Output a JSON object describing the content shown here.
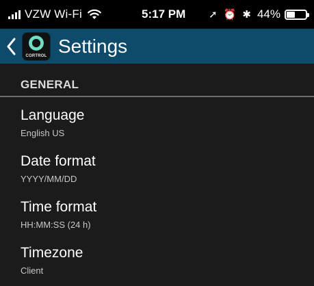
{
  "status_bar": {
    "carrier": "VZW Wi-Fi",
    "time": "5:17 PM",
    "location_glyph": "➚",
    "alarm_glyph": "⏰",
    "bluetooth_glyph": "✱",
    "battery_percent": "44%",
    "battery_level": 0.44
  },
  "nav": {
    "title": "Settings",
    "logo_text": "CORTROL"
  },
  "section": {
    "header": "GENERAL"
  },
  "settings": [
    {
      "title": "Language",
      "value": "English US"
    },
    {
      "title": "Date format",
      "value": "YYYY/MM/DD"
    },
    {
      "title": "Time format",
      "value": "HH:MM:SS (24 h)"
    },
    {
      "title": "Timezone",
      "value": "Client"
    }
  ],
  "colors": {
    "status_bar_bg": "#000000",
    "nav_bar_bg": "#0e4a69",
    "page_bg": "#1b1b1b",
    "divider": "#6d6d6d"
  }
}
